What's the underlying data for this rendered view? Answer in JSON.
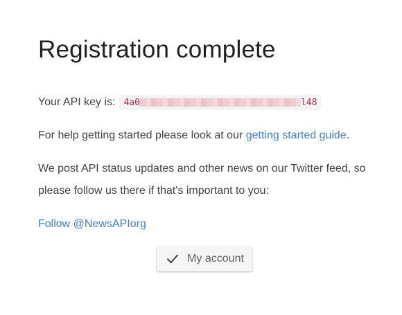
{
  "page": {
    "title": "Registration complete"
  },
  "api_key": {
    "label": "Your API key is:",
    "visible_prefix": "4a0",
    "visible_suffix": "l48"
  },
  "help": {
    "text_before": "For help getting started please look at our ",
    "link_text": "getting started guide",
    "text_after": "."
  },
  "news": {
    "text": "We post API status updates and other news on our Twitter feed, so please follow us there if that's important to you:"
  },
  "twitter": {
    "link_text": "Follow @NewsAPIorg"
  },
  "account_button": {
    "label": "My account",
    "icon": "check-icon"
  },
  "colors": {
    "link": "#3f7fd3",
    "code_text": "#c7254e",
    "code_bg": "#f4f4f4",
    "text": "#424242",
    "title": "#212121"
  }
}
